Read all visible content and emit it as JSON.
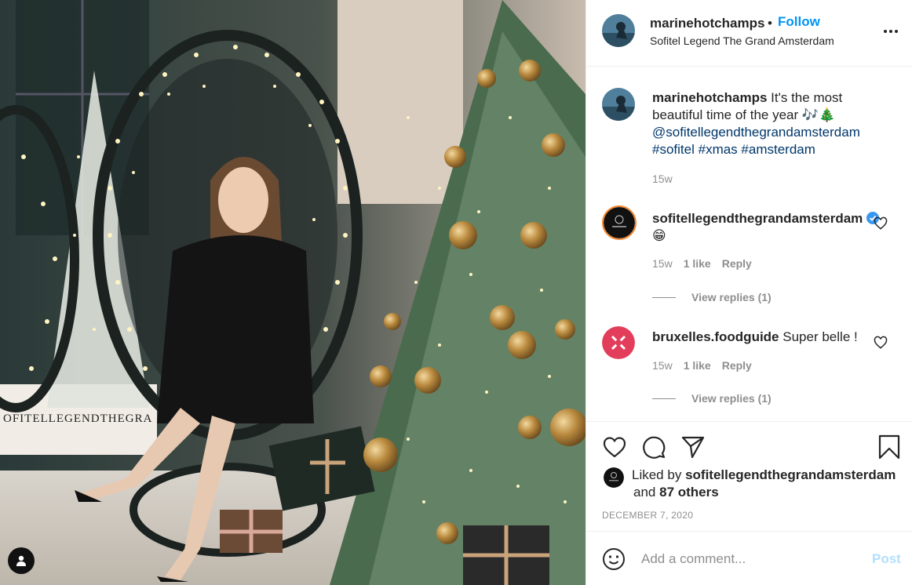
{
  "photo": {
    "sign_text": "OFITELLEGENDTHEGRA",
    "user_tag_icon": "user-icon"
  },
  "header": {
    "username": "marinehotchamps",
    "dot": "•",
    "follow_label": "Follow",
    "location": "Sofitel Legend The Grand Amsterdam",
    "more_icon": "more-horizontal-icon"
  },
  "caption": {
    "username": "marinehotchamps",
    "text": "It's the most beautiful time of the year",
    "emojis": "🎶🎄",
    "mention": "@sofitellegendthegrandamsterdam",
    "hashtags": [
      "#sofitel",
      "#xmas",
      "#amsterdam"
    ],
    "time": "15w"
  },
  "comments": [
    {
      "username": "sofitellegendthegrandamsterdam",
      "verified": true,
      "text": "😁",
      "time": "15w",
      "likes": "1 like",
      "reply_label": "Reply",
      "view_replies": "View replies (1)"
    },
    {
      "username": "bruxelles.foodguide",
      "verified": false,
      "text": "Super belle !",
      "time": "15w",
      "likes": "1 like",
      "reply_label": "Reply",
      "view_replies": "View replies (1)"
    }
  ],
  "actions": {
    "like_icon": "heart-icon",
    "comment_icon": "comment-icon",
    "share_icon": "send-icon",
    "save_icon": "bookmark-icon"
  },
  "likes": {
    "prefix": "Liked by",
    "user": "sofitellegendthegrandamsterdam",
    "and": "and",
    "others": "87 others"
  },
  "date": "DECEMBER 7, 2020",
  "add_comment": {
    "placeholder": "Add a comment...",
    "post_label": "Post"
  },
  "colors": {
    "accent": "#0095f6",
    "link": "#00376b",
    "muted": "#8e8e8e",
    "post_disabled": "#b2dffc"
  }
}
